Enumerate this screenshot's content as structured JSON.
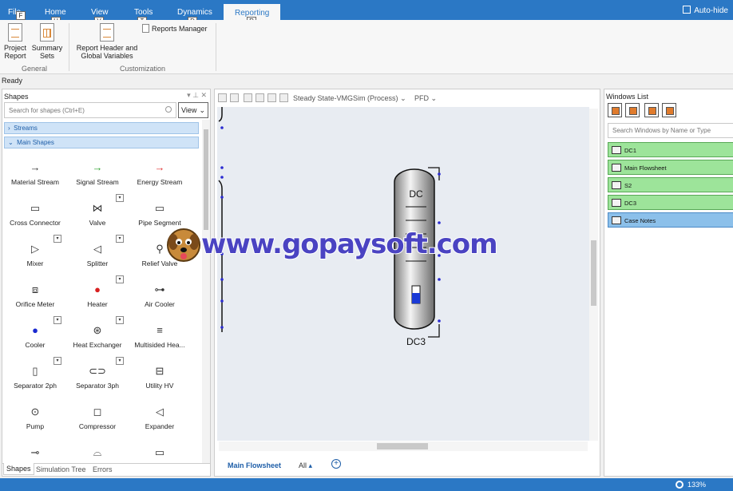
{
  "menu": {
    "tabs": [
      "File",
      "Home",
      "View",
      "Tools",
      "Dynamics",
      "Reporting"
    ],
    "keytips": [
      "F",
      "H",
      "V",
      "T",
      "D",
      "R"
    ],
    "active": "Reporting",
    "autohide": "Auto-hide"
  },
  "ribbon": {
    "project_report": "Project\nReport",
    "summary_sets": "Summary\nSets",
    "report_header": "Report Header and\nGlobal Variables",
    "reports_manager": "Reports Manager",
    "group_general": "General",
    "group_customization": "Customization"
  },
  "status": {
    "ready": "Ready",
    "zoom": "133%"
  },
  "shapes": {
    "title": "Shapes",
    "search_placeholder": "Search for shapes (Ctrl+E)",
    "view_label": "View",
    "streams": "Streams",
    "main_shapes": "Main Shapes",
    "items": [
      {
        "label": "Material Stream",
        "icon": "→"
      },
      {
        "label": "Signal Stream",
        "icon": "→"
      },
      {
        "label": "Energy Stream",
        "icon": "→"
      },
      {
        "label": "Cross Connector",
        "icon": "▭"
      },
      {
        "label": "Valve",
        "icon": "⋈"
      },
      {
        "label": "Pipe Segment",
        "icon": "▭"
      },
      {
        "label": "Mixer",
        "icon": "▷"
      },
      {
        "label": "Splitter",
        "icon": "◁"
      },
      {
        "label": "Relief Valve",
        "icon": "⚲"
      },
      {
        "label": "Orifice Meter",
        "icon": "⧈"
      },
      {
        "label": "Heater",
        "icon": "●"
      },
      {
        "label": "Air Cooler",
        "icon": "⊶"
      },
      {
        "label": "Cooler",
        "icon": "●"
      },
      {
        "label": "Heat Exchanger",
        "icon": "⊛"
      },
      {
        "label": "Multisided Hea...",
        "icon": "≡"
      },
      {
        "label": "Separator 2ph",
        "icon": "▯"
      },
      {
        "label": "Separator 3ph",
        "icon": "⊂⊃"
      },
      {
        "label": "Utility HV",
        "icon": "⊟"
      },
      {
        "label": "Pump",
        "icon": "⊙"
      },
      {
        "label": "Compressor",
        "icon": "◻"
      },
      {
        "label": "Expander",
        "icon": "◁"
      },
      {
        "label": "",
        "icon": "⊸"
      },
      {
        "label": "",
        "icon": "⌓"
      },
      {
        "label": "",
        "icon": "▭"
      }
    ],
    "bottom_tabs": [
      "Shapes",
      "Simulation Tree",
      "Errors"
    ]
  },
  "flowsheet": {
    "toolbar_case": "Steady State-VMGSim (Process)",
    "toolbar_view": "PFD",
    "column_label_top": "DC",
    "column_label": "DC3",
    "tab_main": "Main Flowsheet",
    "tab_all": "All",
    "colors": {
      "canvas": "#e8ecf2",
      "port": "#2b2bd1",
      "level": "#1a3ad6"
    }
  },
  "windows": {
    "title": "Windows List",
    "search_placeholder": "Search Windows by Name or Type",
    "items": [
      {
        "label": "DC1",
        "selected": false
      },
      {
        "label": "Main Flowsheet",
        "selected": false
      },
      {
        "label": "S2",
        "selected": false
      },
      {
        "label": "DC3",
        "selected": false
      },
      {
        "label": "Case Notes",
        "selected": true
      }
    ]
  },
  "watermark": "www.gopaysoft.com"
}
